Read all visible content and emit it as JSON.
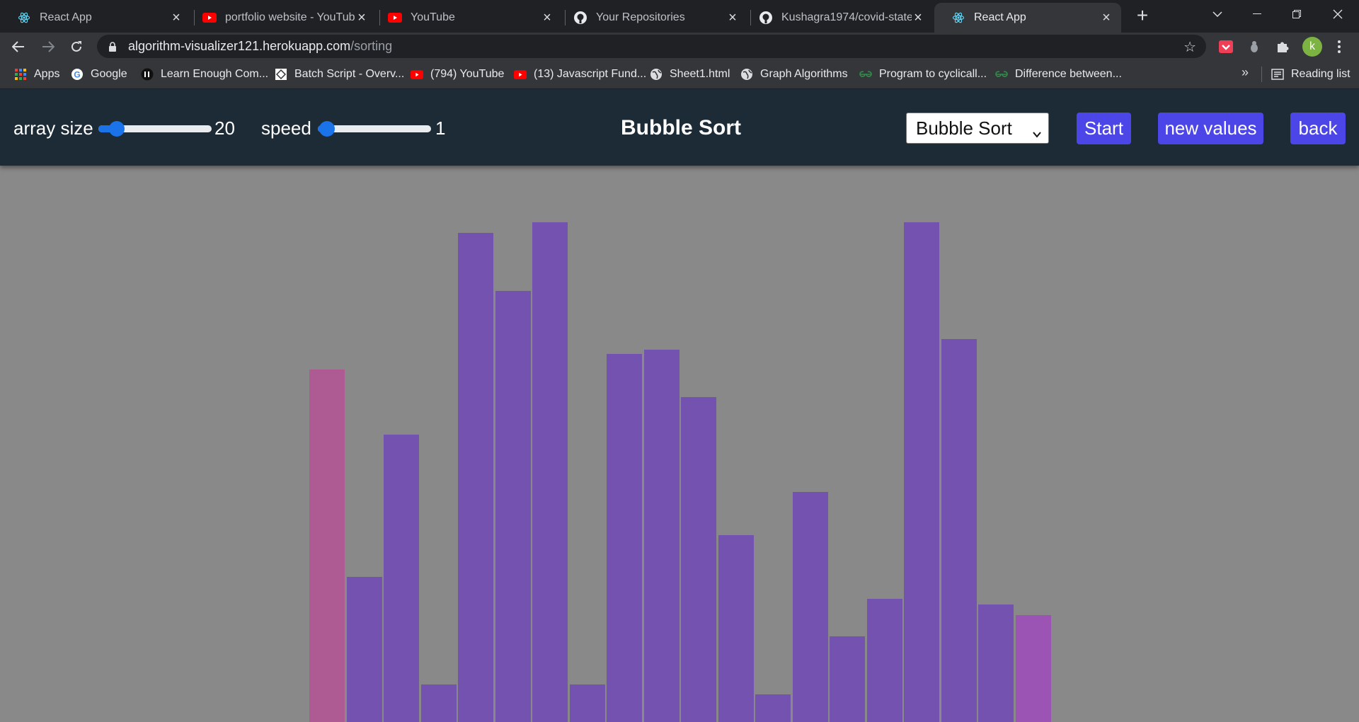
{
  "browser": {
    "tabs": [
      {
        "title": "React App",
        "icon": "react-icon"
      },
      {
        "title": "portfolio website - YouTube",
        "icon": "youtube-icon"
      },
      {
        "title": "YouTube",
        "icon": "youtube-icon"
      },
      {
        "title": "Your Repositories",
        "icon": "github-icon"
      },
      {
        "title": "Kushagra1974/covid-state",
        "icon": "github-icon"
      },
      {
        "title": "React App",
        "icon": "react-icon",
        "active": true
      }
    ],
    "url": {
      "host": "algorithm-visualizer121.herokuapp.com",
      "path": "/sorting"
    },
    "profile_initial": "k",
    "bookmarks": [
      {
        "label": "Apps",
        "icon": "apps-grid-icon"
      },
      {
        "label": "Google",
        "icon": "google-icon"
      },
      {
        "label": "Learn Enough Com...",
        "icon": "learn-enough-icon"
      },
      {
        "label": "Batch Script - Overv...",
        "icon": "tutorialspoint-icon"
      },
      {
        "label": "(794) YouTube",
        "icon": "youtube-icon"
      },
      {
        "label": "(13) Javascript Fund...",
        "icon": "youtube-icon"
      },
      {
        "label": "Sheet1.html",
        "icon": "globe-icon"
      },
      {
        "label": "Graph Algorithms",
        "icon": "globe-icon"
      },
      {
        "label": "Program to cyclicall...",
        "icon": "gfg-icon"
      },
      {
        "label": "Difference between...",
        "icon": "gfg-icon"
      }
    ],
    "reading_list": "Reading list"
  },
  "controls": {
    "array_size_label": "array size",
    "array_size_value": "20",
    "array_size_fraction": 0.1,
    "speed_label": "speed",
    "speed_value": "1",
    "speed_fraction": 0.0
  },
  "title": "Bubble Sort",
  "algorithm_select": {
    "selected": "Bubble Sort"
  },
  "buttons": {
    "start": "Start",
    "new_values": "new values",
    "back": "back"
  },
  "colors": {
    "header_bg": "#1d2b36",
    "canvas_bg": "#898989",
    "bar_default": "#7452b0",
    "bar_compare": "#ad5b92",
    "bar_last": "#9b54b4",
    "button_bg": "#4c46e8"
  },
  "chart_data": {
    "type": "bar",
    "values": [
      498,
      205,
      406,
      53,
      691,
      609,
      706,
      53,
      520,
      526,
      459,
      264,
      39,
      325,
      121,
      174,
      706,
      541,
      166,
      151
    ],
    "highlight": {
      "0": "compare",
      "19": "last"
    }
  }
}
